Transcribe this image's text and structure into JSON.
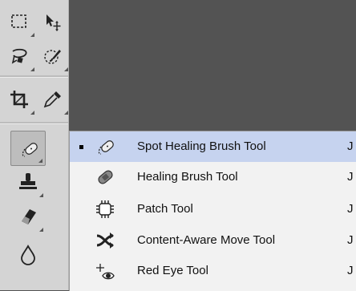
{
  "toolbar": {
    "tools": [
      {
        "name": "rectangular-marquee-tool",
        "icon": "dashed-rectangle"
      },
      {
        "name": "move-tool",
        "icon": "arrow-with-crosshair"
      },
      {
        "name": "lasso-tool",
        "icon": "magnetic-lasso"
      },
      {
        "name": "quick-selection-tool",
        "icon": "brush-selection"
      },
      {
        "name": "crop-tool",
        "icon": "crop"
      },
      {
        "name": "eyedropper-tool",
        "icon": "eyedropper"
      },
      {
        "name": "spot-healing-brush-tool",
        "icon": "bandage",
        "active": true
      },
      {
        "name": "clone-stamp-tool",
        "icon": "stamp"
      },
      {
        "name": "eraser-tool",
        "icon": "eraser"
      },
      {
        "name": "blur-tool",
        "icon": "water-drop"
      }
    ]
  },
  "flyout": {
    "items": [
      {
        "label": "Spot Healing Brush Tool",
        "shortcut": "J",
        "selected": true,
        "icon": "spot-healing-icon"
      },
      {
        "label": "Healing Brush Tool",
        "shortcut": "J",
        "selected": false,
        "icon": "bandage-icon"
      },
      {
        "label": "Patch Tool",
        "shortcut": "J",
        "selected": false,
        "icon": "patch-icon"
      },
      {
        "label": "Content-Aware Move Tool",
        "shortcut": "J",
        "selected": false,
        "icon": "crossed-arrows-icon"
      },
      {
        "label": "Red Eye Tool",
        "shortcut": "J",
        "selected": false,
        "icon": "red-eye-icon"
      }
    ]
  },
  "colors": {
    "canvas": "#535353",
    "toolbar": "#d4d4d4",
    "selected_row": "#c6d3ef"
  }
}
